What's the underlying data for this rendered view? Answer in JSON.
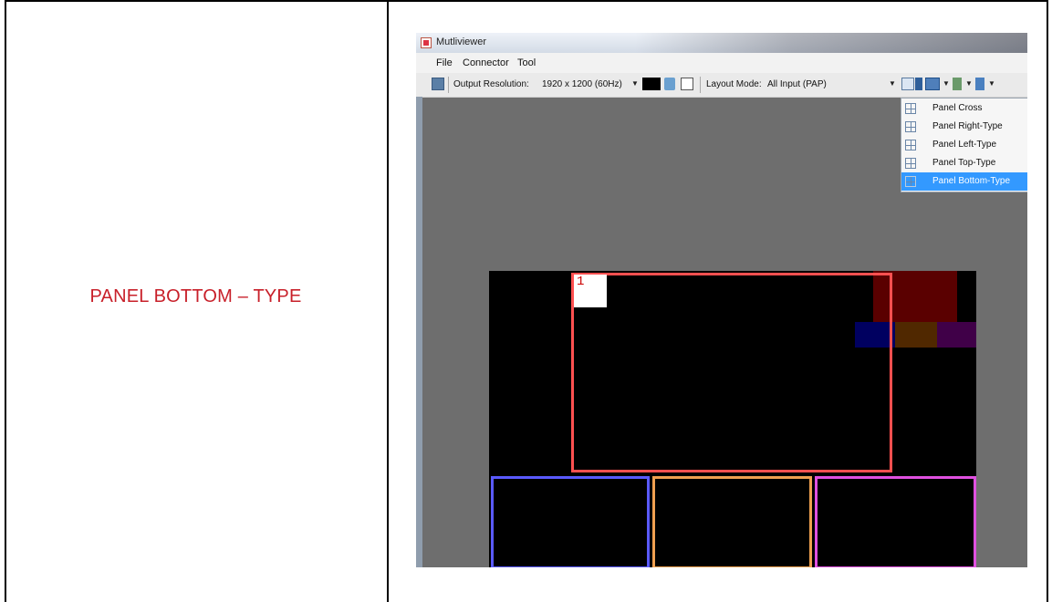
{
  "label": "PANEL BOTTOM – TYPE",
  "window": {
    "title": "Mutliviewer"
  },
  "menu": {
    "items": [
      "File",
      "Connector",
      "Tool"
    ]
  },
  "toolbar": {
    "output_resolution_label": "Output Resolution:",
    "output_resolution_value": "1920 x 1200 (60Hz)",
    "layout_mode_label": "Layout Mode:",
    "layout_mode_value": "All Input (PAP)"
  },
  "dropdown": {
    "items": [
      {
        "label": "Panel Cross",
        "selected": false
      },
      {
        "label": "Panel Right-Type",
        "selected": false
      },
      {
        "label": "Panel Left-Type",
        "selected": false
      },
      {
        "label": "Panel Top-Type",
        "selected": false
      },
      {
        "label": "Panel Bottom-Type",
        "selected": true
      }
    ]
  },
  "canvas": {
    "main_label": "1",
    "colors": {
      "main": "#ff5050",
      "bottom1": "#5a5aff",
      "bottom2": "#f0a050",
      "bottom3": "#e050e0",
      "mini_red": "#5a0000",
      "mini_blue": "#000060",
      "mini_orange": "#502800",
      "mini_purple": "#400048"
    }
  }
}
